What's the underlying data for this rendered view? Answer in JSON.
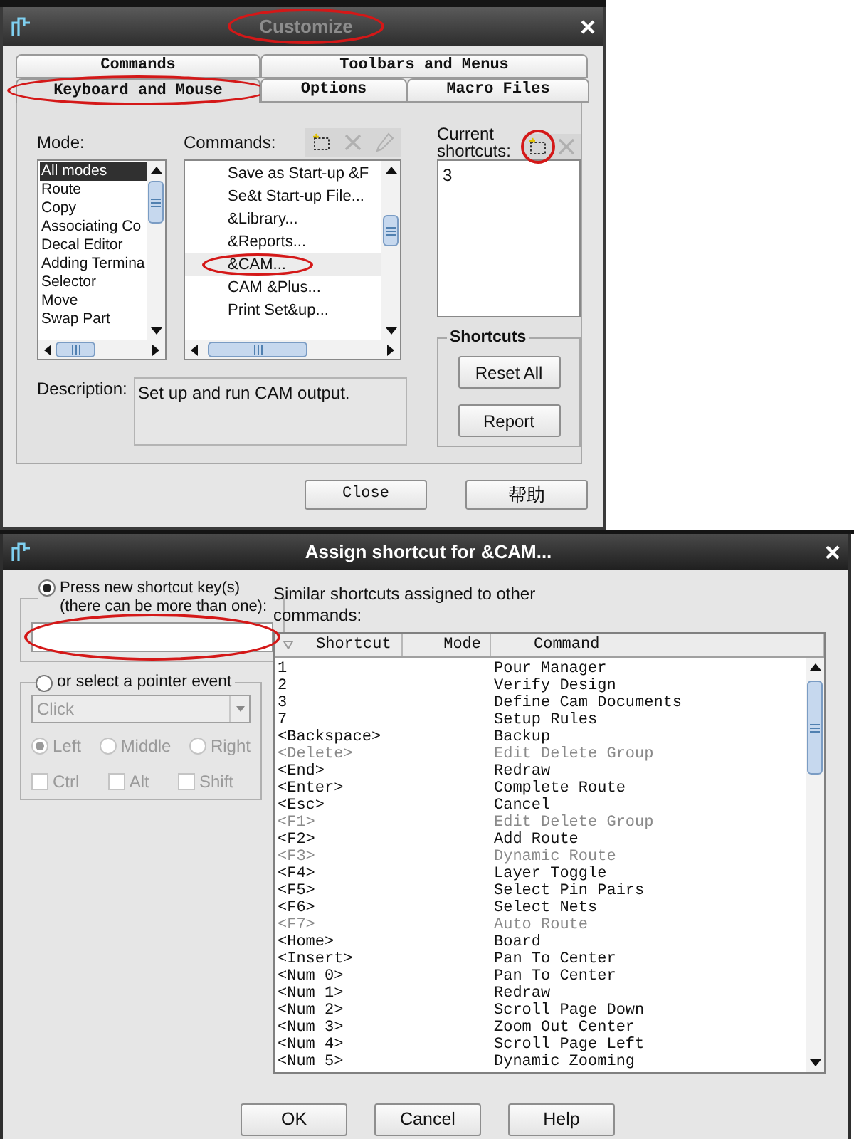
{
  "customize": {
    "title": "Customize",
    "title_circled": true,
    "tab_rows": [
      [
        {
          "label": "Commands",
          "selected": false,
          "circled": false
        },
        {
          "label": "Toolbars and Menus",
          "selected": false,
          "circled": false
        }
      ],
      [
        {
          "label": "Keyboard and Mouse",
          "selected": true,
          "circled": true
        },
        {
          "label": "Options",
          "selected": false,
          "circled": false
        },
        {
          "label": "Macro Files",
          "selected": false,
          "circled": false
        }
      ]
    ],
    "mode": {
      "label": "Mode:",
      "items": [
        {
          "label": "All modes",
          "selected": true
        },
        {
          "label": "Route",
          "selected": false
        },
        {
          "label": "Copy",
          "selected": false
        },
        {
          "label": "Associating Co",
          "selected": false
        },
        {
          "label": "Decal Editor",
          "selected": false
        },
        {
          "label": "Adding Termina",
          "selected": false
        },
        {
          "label": "Selector",
          "selected": false
        },
        {
          "label": "Move",
          "selected": false
        },
        {
          "label": "Swap Part",
          "selected": false
        }
      ]
    },
    "commands": {
      "label": "Commands:",
      "tools": [
        {
          "kind": "new",
          "disabled": false,
          "circled": false
        },
        {
          "kind": "delete",
          "disabled": true,
          "circled": false
        },
        {
          "kind": "edit",
          "disabled": true,
          "circled": false
        }
      ],
      "items": [
        {
          "label": "Save as Start-up &F",
          "selected": false,
          "circled": false
        },
        {
          "label": "Se&t Start-up File...",
          "selected": false,
          "circled": false
        },
        {
          "label": "&Library...",
          "selected": false,
          "circled": false
        },
        {
          "label": "&Reports...",
          "selected": false,
          "circled": false
        },
        {
          "label": "&CAM...",
          "selected": true,
          "circled": true
        },
        {
          "label": "CAM &Plus...",
          "selected": false,
          "circled": false
        },
        {
          "label": "Print Set&up...",
          "selected": false,
          "circled": false
        }
      ]
    },
    "current_shortcuts": {
      "label": "Current shortcuts:",
      "tools": [
        {
          "kind": "new",
          "disabled": false,
          "circled": true
        },
        {
          "kind": "delete",
          "disabled": true,
          "circled": false
        }
      ],
      "items": [
        "3"
      ]
    },
    "shortcuts_group": {
      "title": "Shortcuts",
      "buttons": [
        "Reset All",
        "Report"
      ]
    },
    "description": {
      "label": "Description:",
      "text": "Set up and run CAM output."
    },
    "buttons": [
      "Close",
      "帮助"
    ]
  },
  "assign": {
    "title": "Assign shortcut for &CAM...",
    "key_group": {
      "label": "Press new shortcut key(s) (there can be more than one):",
      "selected": true,
      "circled": true
    },
    "pointer_group": {
      "label": "or select a pointer event",
      "selected": false,
      "disabled": true,
      "dropdown": "Click",
      "buttons": [
        {
          "label": "Left",
          "selected": true
        },
        {
          "label": "Middle",
          "selected": false
        },
        {
          "label": "Right",
          "selected": false
        }
      ],
      "modifiers": [
        {
          "label": "Ctrl",
          "checked": false
        },
        {
          "label": "Alt",
          "checked": false
        },
        {
          "label": "Shift",
          "checked": false
        }
      ]
    },
    "similar_label": "Similar shortcuts assigned to other commands:",
    "table": {
      "columns": [
        "Shortcut",
        "Mode",
        "Command"
      ],
      "rows": [
        {
          "shortcut": "1",
          "command": "Pour Manager",
          "disabled": false
        },
        {
          "shortcut": "2",
          "command": "Verify Design",
          "disabled": false
        },
        {
          "shortcut": "3",
          "command": "Define Cam Documents",
          "disabled": false
        },
        {
          "shortcut": "7",
          "command": "Setup Rules",
          "disabled": false
        },
        {
          "shortcut": "<Backspace>",
          "command": "Backup",
          "disabled": false
        },
        {
          "shortcut": "<Delete>",
          "command": "Edit Delete Group",
          "disabled": true
        },
        {
          "shortcut": "<End>",
          "command": "Redraw",
          "disabled": false
        },
        {
          "shortcut": "<Enter>",
          "command": "Complete Route",
          "disabled": false
        },
        {
          "shortcut": "<Esc>",
          "command": "Cancel",
          "disabled": false
        },
        {
          "shortcut": "<F1>",
          "command": "Edit Delete Group",
          "disabled": true
        },
        {
          "shortcut": "<F2>",
          "command": "Add Route",
          "disabled": false
        },
        {
          "shortcut": "<F3>",
          "command": "Dynamic Route",
          "disabled": true
        },
        {
          "shortcut": "<F4>",
          "command": "Layer Toggle",
          "disabled": false
        },
        {
          "shortcut": "<F5>",
          "command": "Select Pin Pairs",
          "disabled": false
        },
        {
          "shortcut": "<F6>",
          "command": "Select Nets",
          "disabled": false
        },
        {
          "shortcut": "<F7>",
          "command": "Auto Route",
          "disabled": true
        },
        {
          "shortcut": "<Home>",
          "command": "Board",
          "disabled": false
        },
        {
          "shortcut": "<Insert>",
          "command": "Pan To Center",
          "disabled": false
        },
        {
          "shortcut": "<Num 0>",
          "command": "Pan To Center",
          "disabled": false
        },
        {
          "shortcut": "<Num 1>",
          "command": "Redraw",
          "disabled": false
        },
        {
          "shortcut": "<Num 2>",
          "command": "Scroll Page Down",
          "disabled": false
        },
        {
          "shortcut": "<Num 3>",
          "command": "Zoom Out Center",
          "disabled": false
        },
        {
          "shortcut": "<Num 4>",
          "command": "Scroll Page Left",
          "disabled": false
        },
        {
          "shortcut": "<Num 5>",
          "command": "Dynamic Zooming",
          "disabled": false
        }
      ]
    },
    "buttons": [
      "OK",
      "Cancel",
      "Help"
    ]
  }
}
